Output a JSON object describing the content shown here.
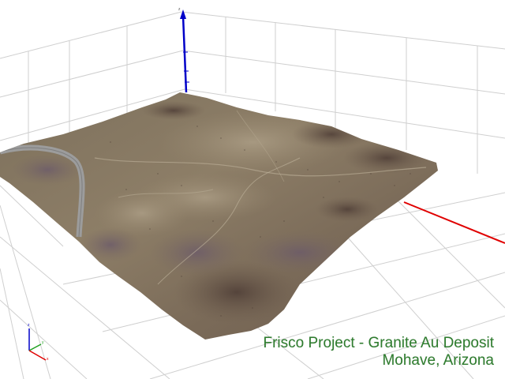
{
  "viewer": {
    "caption": {
      "title": "Frisco Project - Granite Au Deposit",
      "subtitle": "Mohave, Arizona",
      "color": "#2e7d2e"
    },
    "axes": {
      "z_axis_label": "z",
      "colors": {
        "x": "#e00000",
        "y": "#1fa01f",
        "z": "#0000c8"
      }
    },
    "triad": {
      "x_label": "x",
      "y_label": "y",
      "z_label": "z"
    },
    "terrain": {
      "description_colors": {
        "base": "#8a7a63",
        "dark": "#5c4a3f",
        "light": "#a99a82",
        "road": "#9c9c9c"
      }
    }
  }
}
